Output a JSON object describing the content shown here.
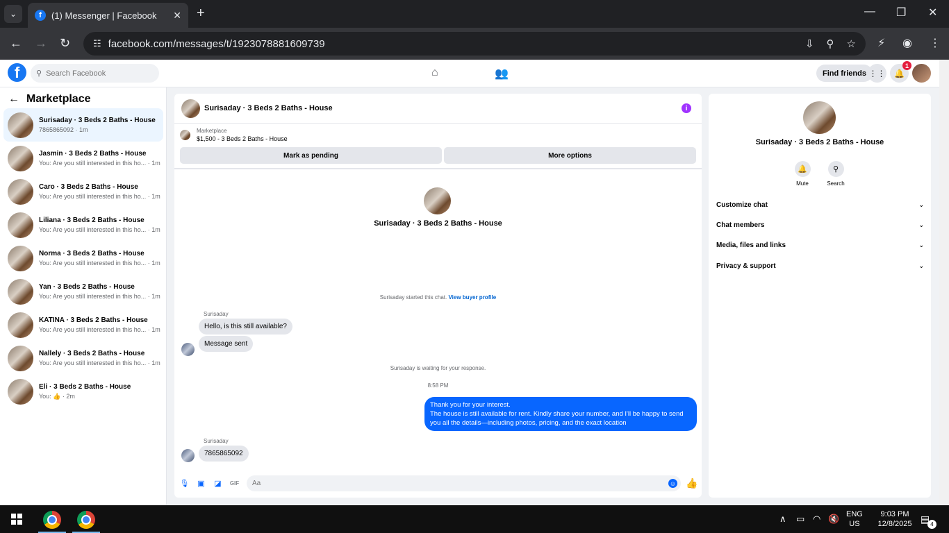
{
  "browser": {
    "tab_title": "(1) Messenger | Facebook",
    "url": "facebook.com/messages/t/1923078881609739"
  },
  "fb": {
    "search_placeholder": "Search Facebook",
    "find_friends": "Find friends",
    "notification_count": "1"
  },
  "left": {
    "title": "Marketplace",
    "conversations": [
      {
        "name": "Surisaday · 3 Beds 2 Baths - House",
        "preview": "7865865092 · 1m",
        "active": true
      },
      {
        "name": "Jasmin · 3 Beds 2 Baths - House",
        "preview": "You: Are you still interested in this ho... · 1m"
      },
      {
        "name": "Caro · 3 Beds 2 Baths - House",
        "preview": "You: Are you still interested in this ho... · 1m"
      },
      {
        "name": "Liliana · 3 Beds 2 Baths - House",
        "preview": "You: Are you still interested in this ho... · 1m"
      },
      {
        "name": "Norma · 3 Beds 2 Baths - House",
        "preview": "You: Are you still interested in this ho... · 1m"
      },
      {
        "name": "Yan · 3 Beds 2 Baths - House",
        "preview": "You: Are you still interested in this ho... · 1m"
      },
      {
        "name": "KATINA · 3 Beds 2 Baths - House",
        "preview": "You: Are you still interested in this ho... · 1m"
      },
      {
        "name": "Nallely · 3 Beds 2 Baths - House",
        "preview": "You: Are you still interested in this ho... · 1m"
      },
      {
        "name": "Eli · 3 Beds 2 Baths - House",
        "preview": "You: 👍 · 2m"
      }
    ]
  },
  "chat": {
    "title": "Surisaday · 3 Beds 2 Baths - House",
    "marketplace_label": "Marketplace",
    "listing": "$1,500 - 3 Beds 2 Baths - House",
    "mark_pending": "Mark as pending",
    "more_options": "More options",
    "started_text": "Surisaday started this chat.",
    "view_buyer": "View buyer profile",
    "sender_name": "Surisaday",
    "msg1": "Hello, is this still available?",
    "msg2": "Message sent",
    "waiting": "Surisaday is waiting for your response.",
    "time": "8:58 PM",
    "out_line1": "Thank you for your interest.",
    "out_line2": "The house is still available for rent. Kindly share your number, and I'll be happy to send you all the details—including photos, pricing, and the exact location",
    "msg3": "7865865092",
    "input_placeholder": "Aa"
  },
  "right": {
    "name": "Surisaday · 3 Beds 2 Baths - House",
    "mute": "Mute",
    "search": "Search",
    "sections": [
      "Customize chat",
      "Chat members",
      "Media, files and links",
      "Privacy & support"
    ]
  },
  "taskbar": {
    "lang1": "ENG",
    "lang2": "US",
    "time": "9:03 PM",
    "date": "12/8/2025",
    "notif_count": "4"
  }
}
